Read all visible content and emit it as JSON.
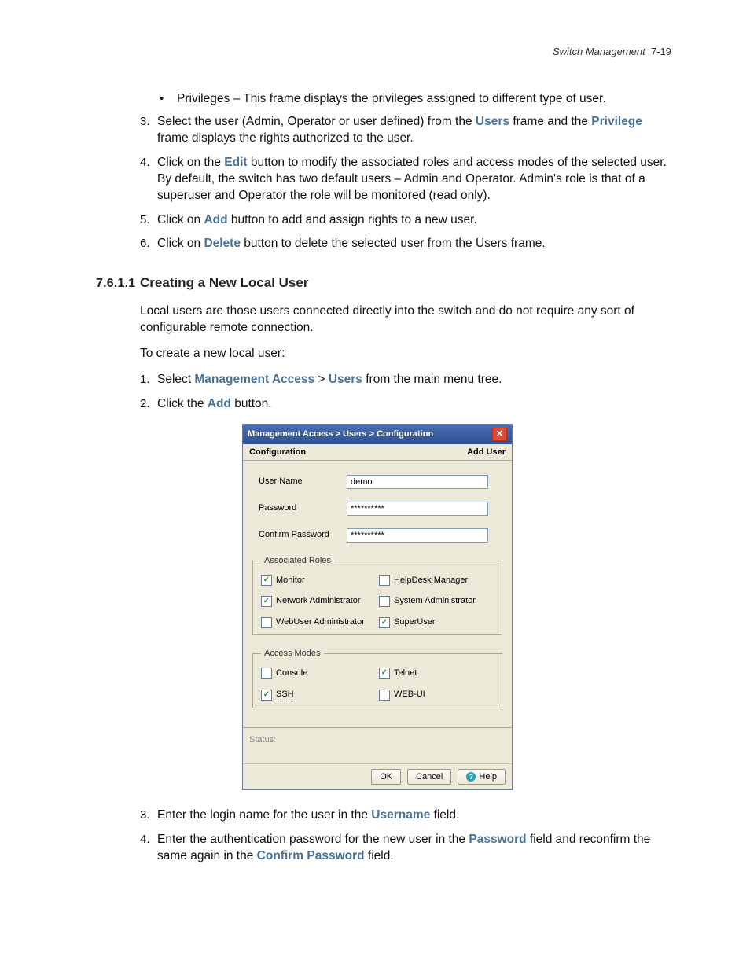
{
  "header": {
    "section": "Switch Management",
    "page": "7-19"
  },
  "body": {
    "bullet": "Privileges – This frame displays the privileges assigned to different type of user.",
    "step3a": "Select the user (Admin, Operator or user defined) from the ",
    "step3_users": "Users",
    "step3b": " frame and the ",
    "step3_priv": "Privilege",
    "step3c": " frame displays the rights authorized to the user.",
    "step4a": "Click on the ",
    "step4_edit": "Edit",
    "step4b": " button to modify the associated roles and access modes of the selected user. By default, the switch has two default users – Admin and Operator. Admin's role is that of a superuser and Operator the role will be monitored (read only).",
    "step5a": "Click on ",
    "step5_add": "Add",
    "step5b": " button to add and assign rights to a new user.",
    "step6a": "Click on ",
    "step6_del": "Delete",
    "step6b": " button to delete the selected user from the Users frame."
  },
  "section": {
    "number": "7.6.1.1",
    "title": "Creating a New Local User",
    "para1": "Local users are those users connected directly into the switch and do not require any sort of configurable remote connection.",
    "para2": "To create a new local user:",
    "s1a": "Select ",
    "s1_ma": "Management Access",
    "s1b": " > ",
    "s1_users": "Users",
    "s1c": " from the main menu tree.",
    "s2a": "Click the ",
    "s2_add": "Add",
    "s2b": " button.",
    "s3a": "Enter the login name for the user in the ",
    "s3_username": "Username",
    "s3b": " field.",
    "s4a": "Enter the authentication password for the new user in the ",
    "s4_password": "Password",
    "s4b": " field and reconfirm the same again in the ",
    "s4_confirm": "Confirm Password",
    "s4c": " field."
  },
  "dialog": {
    "title": "Management Access > Users > Configuration",
    "close": "✕",
    "tab_left": "Configuration",
    "tab_right": "Add User",
    "fields": {
      "username_label": "User Name",
      "username_value": "demo",
      "password_label": "Password",
      "password_value": "**********",
      "confirm_label": "Confirm Password",
      "confirm_value": "**********"
    },
    "roles": {
      "legend": "Associated Roles",
      "items": [
        {
          "label": "Monitor",
          "checked": true
        },
        {
          "label": "HelpDesk Manager",
          "checked": false
        },
        {
          "label": "Network Administrator",
          "checked": true
        },
        {
          "label": "System Administrator",
          "checked": false
        },
        {
          "label": "WebUser Administrator",
          "checked": false
        },
        {
          "label": "SuperUser",
          "checked": true
        }
      ]
    },
    "modes": {
      "legend": "Access Modes",
      "items": [
        {
          "label": "Console",
          "checked": false
        },
        {
          "label": "Telnet",
          "checked": true
        },
        {
          "label": "SSH",
          "checked": true,
          "dotted": true
        },
        {
          "label": "WEB-UI",
          "checked": false
        }
      ]
    },
    "status_label": "Status:",
    "buttons": {
      "ok": "OK",
      "cancel": "Cancel",
      "help": "Help"
    }
  }
}
